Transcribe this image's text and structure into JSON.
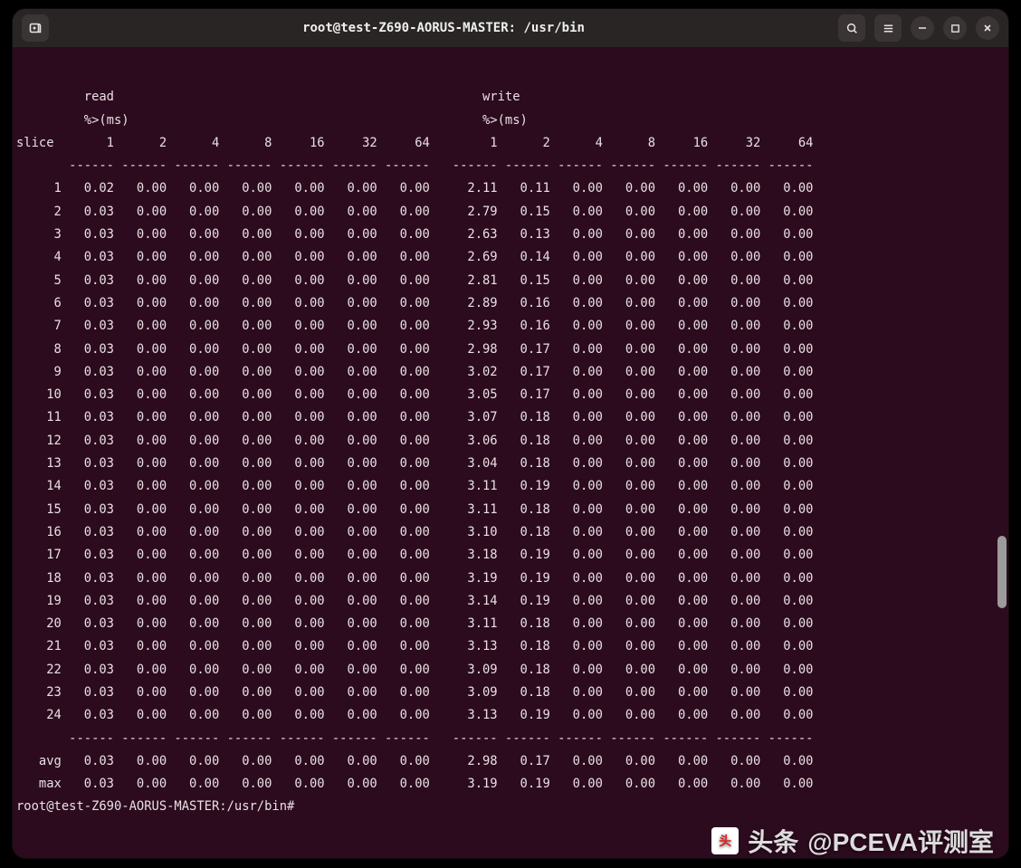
{
  "titlebar": {
    "title": "root@test-Z690-AORUS-MASTER: /usr/bin",
    "newtab_icon": "new-tab-icon",
    "search_icon": "search-icon",
    "menu_icon": "hamburger-icon",
    "min_icon": "minimize-icon",
    "max_icon": "maximize-icon",
    "close_icon": "close-icon"
  },
  "headers": {
    "read": "read",
    "write": "write",
    "pct_ms": "%>(ms)",
    "slice": "slice",
    "cols": [
      "1",
      "2",
      "4",
      "8",
      "16",
      "32",
      "64"
    ]
  },
  "rows": [
    {
      "slice": "1",
      "read": [
        "0.02",
        "0.00",
        "0.00",
        "0.00",
        "0.00",
        "0.00",
        "0.00"
      ],
      "write": [
        "2.11",
        "0.11",
        "0.00",
        "0.00",
        "0.00",
        "0.00",
        "0.00"
      ]
    },
    {
      "slice": "2",
      "read": [
        "0.03",
        "0.00",
        "0.00",
        "0.00",
        "0.00",
        "0.00",
        "0.00"
      ],
      "write": [
        "2.79",
        "0.15",
        "0.00",
        "0.00",
        "0.00",
        "0.00",
        "0.00"
      ]
    },
    {
      "slice": "3",
      "read": [
        "0.03",
        "0.00",
        "0.00",
        "0.00",
        "0.00",
        "0.00",
        "0.00"
      ],
      "write": [
        "2.63",
        "0.13",
        "0.00",
        "0.00",
        "0.00",
        "0.00",
        "0.00"
      ]
    },
    {
      "slice": "4",
      "read": [
        "0.03",
        "0.00",
        "0.00",
        "0.00",
        "0.00",
        "0.00",
        "0.00"
      ],
      "write": [
        "2.69",
        "0.14",
        "0.00",
        "0.00",
        "0.00",
        "0.00",
        "0.00"
      ]
    },
    {
      "slice": "5",
      "read": [
        "0.03",
        "0.00",
        "0.00",
        "0.00",
        "0.00",
        "0.00",
        "0.00"
      ],
      "write": [
        "2.81",
        "0.15",
        "0.00",
        "0.00",
        "0.00",
        "0.00",
        "0.00"
      ]
    },
    {
      "slice": "6",
      "read": [
        "0.03",
        "0.00",
        "0.00",
        "0.00",
        "0.00",
        "0.00",
        "0.00"
      ],
      "write": [
        "2.89",
        "0.16",
        "0.00",
        "0.00",
        "0.00",
        "0.00",
        "0.00"
      ]
    },
    {
      "slice": "7",
      "read": [
        "0.03",
        "0.00",
        "0.00",
        "0.00",
        "0.00",
        "0.00",
        "0.00"
      ],
      "write": [
        "2.93",
        "0.16",
        "0.00",
        "0.00",
        "0.00",
        "0.00",
        "0.00"
      ]
    },
    {
      "slice": "8",
      "read": [
        "0.03",
        "0.00",
        "0.00",
        "0.00",
        "0.00",
        "0.00",
        "0.00"
      ],
      "write": [
        "2.98",
        "0.17",
        "0.00",
        "0.00",
        "0.00",
        "0.00",
        "0.00"
      ]
    },
    {
      "slice": "9",
      "read": [
        "0.03",
        "0.00",
        "0.00",
        "0.00",
        "0.00",
        "0.00",
        "0.00"
      ],
      "write": [
        "3.02",
        "0.17",
        "0.00",
        "0.00",
        "0.00",
        "0.00",
        "0.00"
      ]
    },
    {
      "slice": "10",
      "read": [
        "0.03",
        "0.00",
        "0.00",
        "0.00",
        "0.00",
        "0.00",
        "0.00"
      ],
      "write": [
        "3.05",
        "0.17",
        "0.00",
        "0.00",
        "0.00",
        "0.00",
        "0.00"
      ]
    },
    {
      "slice": "11",
      "read": [
        "0.03",
        "0.00",
        "0.00",
        "0.00",
        "0.00",
        "0.00",
        "0.00"
      ],
      "write": [
        "3.07",
        "0.18",
        "0.00",
        "0.00",
        "0.00",
        "0.00",
        "0.00"
      ]
    },
    {
      "slice": "12",
      "read": [
        "0.03",
        "0.00",
        "0.00",
        "0.00",
        "0.00",
        "0.00",
        "0.00"
      ],
      "write": [
        "3.06",
        "0.18",
        "0.00",
        "0.00",
        "0.00",
        "0.00",
        "0.00"
      ]
    },
    {
      "slice": "13",
      "read": [
        "0.03",
        "0.00",
        "0.00",
        "0.00",
        "0.00",
        "0.00",
        "0.00"
      ],
      "write": [
        "3.04",
        "0.18",
        "0.00",
        "0.00",
        "0.00",
        "0.00",
        "0.00"
      ]
    },
    {
      "slice": "14",
      "read": [
        "0.03",
        "0.00",
        "0.00",
        "0.00",
        "0.00",
        "0.00",
        "0.00"
      ],
      "write": [
        "3.11",
        "0.19",
        "0.00",
        "0.00",
        "0.00",
        "0.00",
        "0.00"
      ]
    },
    {
      "slice": "15",
      "read": [
        "0.03",
        "0.00",
        "0.00",
        "0.00",
        "0.00",
        "0.00",
        "0.00"
      ],
      "write": [
        "3.11",
        "0.18",
        "0.00",
        "0.00",
        "0.00",
        "0.00",
        "0.00"
      ]
    },
    {
      "slice": "16",
      "read": [
        "0.03",
        "0.00",
        "0.00",
        "0.00",
        "0.00",
        "0.00",
        "0.00"
      ],
      "write": [
        "3.10",
        "0.18",
        "0.00",
        "0.00",
        "0.00",
        "0.00",
        "0.00"
      ]
    },
    {
      "slice": "17",
      "read": [
        "0.03",
        "0.00",
        "0.00",
        "0.00",
        "0.00",
        "0.00",
        "0.00"
      ],
      "write": [
        "3.18",
        "0.19",
        "0.00",
        "0.00",
        "0.00",
        "0.00",
        "0.00"
      ]
    },
    {
      "slice": "18",
      "read": [
        "0.03",
        "0.00",
        "0.00",
        "0.00",
        "0.00",
        "0.00",
        "0.00"
      ],
      "write": [
        "3.19",
        "0.19",
        "0.00",
        "0.00",
        "0.00",
        "0.00",
        "0.00"
      ]
    },
    {
      "slice": "19",
      "read": [
        "0.03",
        "0.00",
        "0.00",
        "0.00",
        "0.00",
        "0.00",
        "0.00"
      ],
      "write": [
        "3.14",
        "0.19",
        "0.00",
        "0.00",
        "0.00",
        "0.00",
        "0.00"
      ]
    },
    {
      "slice": "20",
      "read": [
        "0.03",
        "0.00",
        "0.00",
        "0.00",
        "0.00",
        "0.00",
        "0.00"
      ],
      "write": [
        "3.11",
        "0.18",
        "0.00",
        "0.00",
        "0.00",
        "0.00",
        "0.00"
      ]
    },
    {
      "slice": "21",
      "read": [
        "0.03",
        "0.00",
        "0.00",
        "0.00",
        "0.00",
        "0.00",
        "0.00"
      ],
      "write": [
        "3.13",
        "0.18",
        "0.00",
        "0.00",
        "0.00",
        "0.00",
        "0.00"
      ]
    },
    {
      "slice": "22",
      "read": [
        "0.03",
        "0.00",
        "0.00",
        "0.00",
        "0.00",
        "0.00",
        "0.00"
      ],
      "write": [
        "3.09",
        "0.18",
        "0.00",
        "0.00",
        "0.00",
        "0.00",
        "0.00"
      ]
    },
    {
      "slice": "23",
      "read": [
        "0.03",
        "0.00",
        "0.00",
        "0.00",
        "0.00",
        "0.00",
        "0.00"
      ],
      "write": [
        "3.09",
        "0.18",
        "0.00",
        "0.00",
        "0.00",
        "0.00",
        "0.00"
      ]
    },
    {
      "slice": "24",
      "read": [
        "0.03",
        "0.00",
        "0.00",
        "0.00",
        "0.00",
        "0.00",
        "0.00"
      ],
      "write": [
        "3.13",
        "0.19",
        "0.00",
        "0.00",
        "0.00",
        "0.00",
        "0.00"
      ]
    }
  ],
  "summary": {
    "avg": {
      "label": "avg",
      "read": [
        "0.03",
        "0.00",
        "0.00",
        "0.00",
        "0.00",
        "0.00",
        "0.00"
      ],
      "write": [
        "2.98",
        "0.17",
        "0.00",
        "0.00",
        "0.00",
        "0.00",
        "0.00"
      ]
    },
    "max": {
      "label": "max",
      "read": [
        "0.03",
        "0.00",
        "0.00",
        "0.00",
        "0.00",
        "0.00",
        "0.00"
      ],
      "write": [
        "3.19",
        "0.19",
        "0.00",
        "0.00",
        "0.00",
        "0.00",
        "0.00"
      ]
    }
  },
  "prompt": "root@test-Z690-AORUS-MASTER:/usr/bin#",
  "watermark": {
    "prefix": "头条",
    "handle": "@PCEVA评测室"
  }
}
